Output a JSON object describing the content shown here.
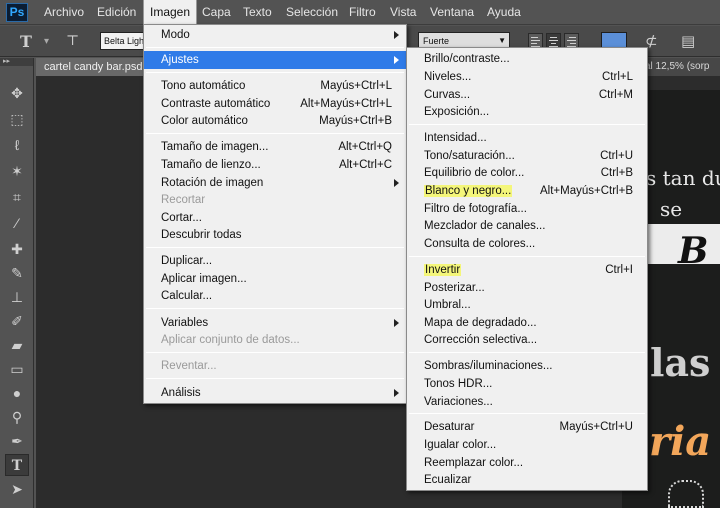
{
  "app": {
    "logo": "Ps"
  },
  "menubar": {
    "items": [
      {
        "label": "Archivo"
      },
      {
        "label": "Edición"
      },
      {
        "label": "Imagen"
      },
      {
        "label": "Capa"
      },
      {
        "label": "Texto"
      },
      {
        "label": "Selección"
      },
      {
        "label": "Filtro"
      },
      {
        "label": "Vista"
      },
      {
        "label": "Ventana"
      },
      {
        "label": "Ayuda"
      }
    ],
    "active": "Imagen"
  },
  "options_bar": {
    "font_family": "Belta Light",
    "antialias": "Fuerte",
    "text_color": "#5b8fd8"
  },
  "document": {
    "tab_title": "cartel candy bar.psd",
    "tab_zoom_fragment": "al 12,5% (sorp",
    "art": {
      "line1": "s tan dul",
      "line2": "se",
      "ribbon_letter": "B",
      "line3": "las",
      "line4": "ria"
    }
  },
  "image_menu": {
    "groups": [
      [
        {
          "label": "Modo",
          "submenu": true
        }
      ],
      [
        {
          "label": "Ajustes",
          "submenu": true,
          "highlighted": true
        }
      ],
      [
        {
          "label": "Tono automático",
          "shortcut": "Mayús+Ctrl+L"
        },
        {
          "label": "Contraste automático",
          "shortcut": "Alt+Mayús+Ctrl+L"
        },
        {
          "label": "Color automático",
          "shortcut": "Mayús+Ctrl+B"
        }
      ],
      [
        {
          "label": "Tamaño de imagen...",
          "shortcut": "Alt+Ctrl+Q"
        },
        {
          "label": "Tamaño de lienzo...",
          "shortcut": "Alt+Ctrl+C"
        },
        {
          "label": "Rotación de imagen",
          "submenu": true
        },
        {
          "label": "Recortar",
          "disabled": true
        },
        {
          "label": "Cortar..."
        },
        {
          "label": "Descubrir todas"
        }
      ],
      [
        {
          "label": "Duplicar..."
        },
        {
          "label": "Aplicar imagen..."
        },
        {
          "label": "Calcular..."
        }
      ],
      [
        {
          "label": "Variables",
          "submenu": true
        },
        {
          "label": "Aplicar conjunto de datos...",
          "disabled": true
        }
      ],
      [
        {
          "label": "Reventar...",
          "disabled": true
        }
      ],
      [
        {
          "label": "Análisis",
          "submenu": true
        }
      ]
    ]
  },
  "adjust_menu": {
    "groups": [
      [
        {
          "label": "Brillo/contraste..."
        },
        {
          "label": "Niveles...",
          "shortcut": "Ctrl+L"
        },
        {
          "label": "Curvas...",
          "shortcut": "Ctrl+M"
        },
        {
          "label": "Exposición..."
        }
      ],
      [
        {
          "label": "Intensidad..."
        },
        {
          "label": "Tono/saturación...",
          "shortcut": "Ctrl+U"
        },
        {
          "label": "Equilibrio de color...",
          "shortcut": "Ctrl+B"
        },
        {
          "label": "Blanco y negro...",
          "shortcut": "Alt+Mayús+Ctrl+B",
          "marked": true
        },
        {
          "label": "Filtro de fotografía..."
        },
        {
          "label": "Mezclador de canales..."
        },
        {
          "label": "Consulta de colores..."
        }
      ],
      [
        {
          "label": "Invertir",
          "shortcut": "Ctrl+I",
          "marked": true
        },
        {
          "label": "Posterizar..."
        },
        {
          "label": "Umbral..."
        },
        {
          "label": "Mapa de degradado..."
        },
        {
          "label": "Corrección selectiva..."
        }
      ],
      [
        {
          "label": "Sombras/iluminaciones..."
        },
        {
          "label": "Tonos HDR..."
        },
        {
          "label": "Variaciones..."
        }
      ],
      [
        {
          "label": "Desaturar",
          "shortcut": "Mayús+Ctrl+U"
        },
        {
          "label": "Igualar color..."
        },
        {
          "label": "Reemplazar color..."
        },
        {
          "label": "Ecualizar"
        }
      ]
    ]
  },
  "colors": {
    "menu_bg": "#f0f0f0",
    "highlight": "#2f7be8",
    "marker": "#f4f67a",
    "chrome": "#535353"
  }
}
